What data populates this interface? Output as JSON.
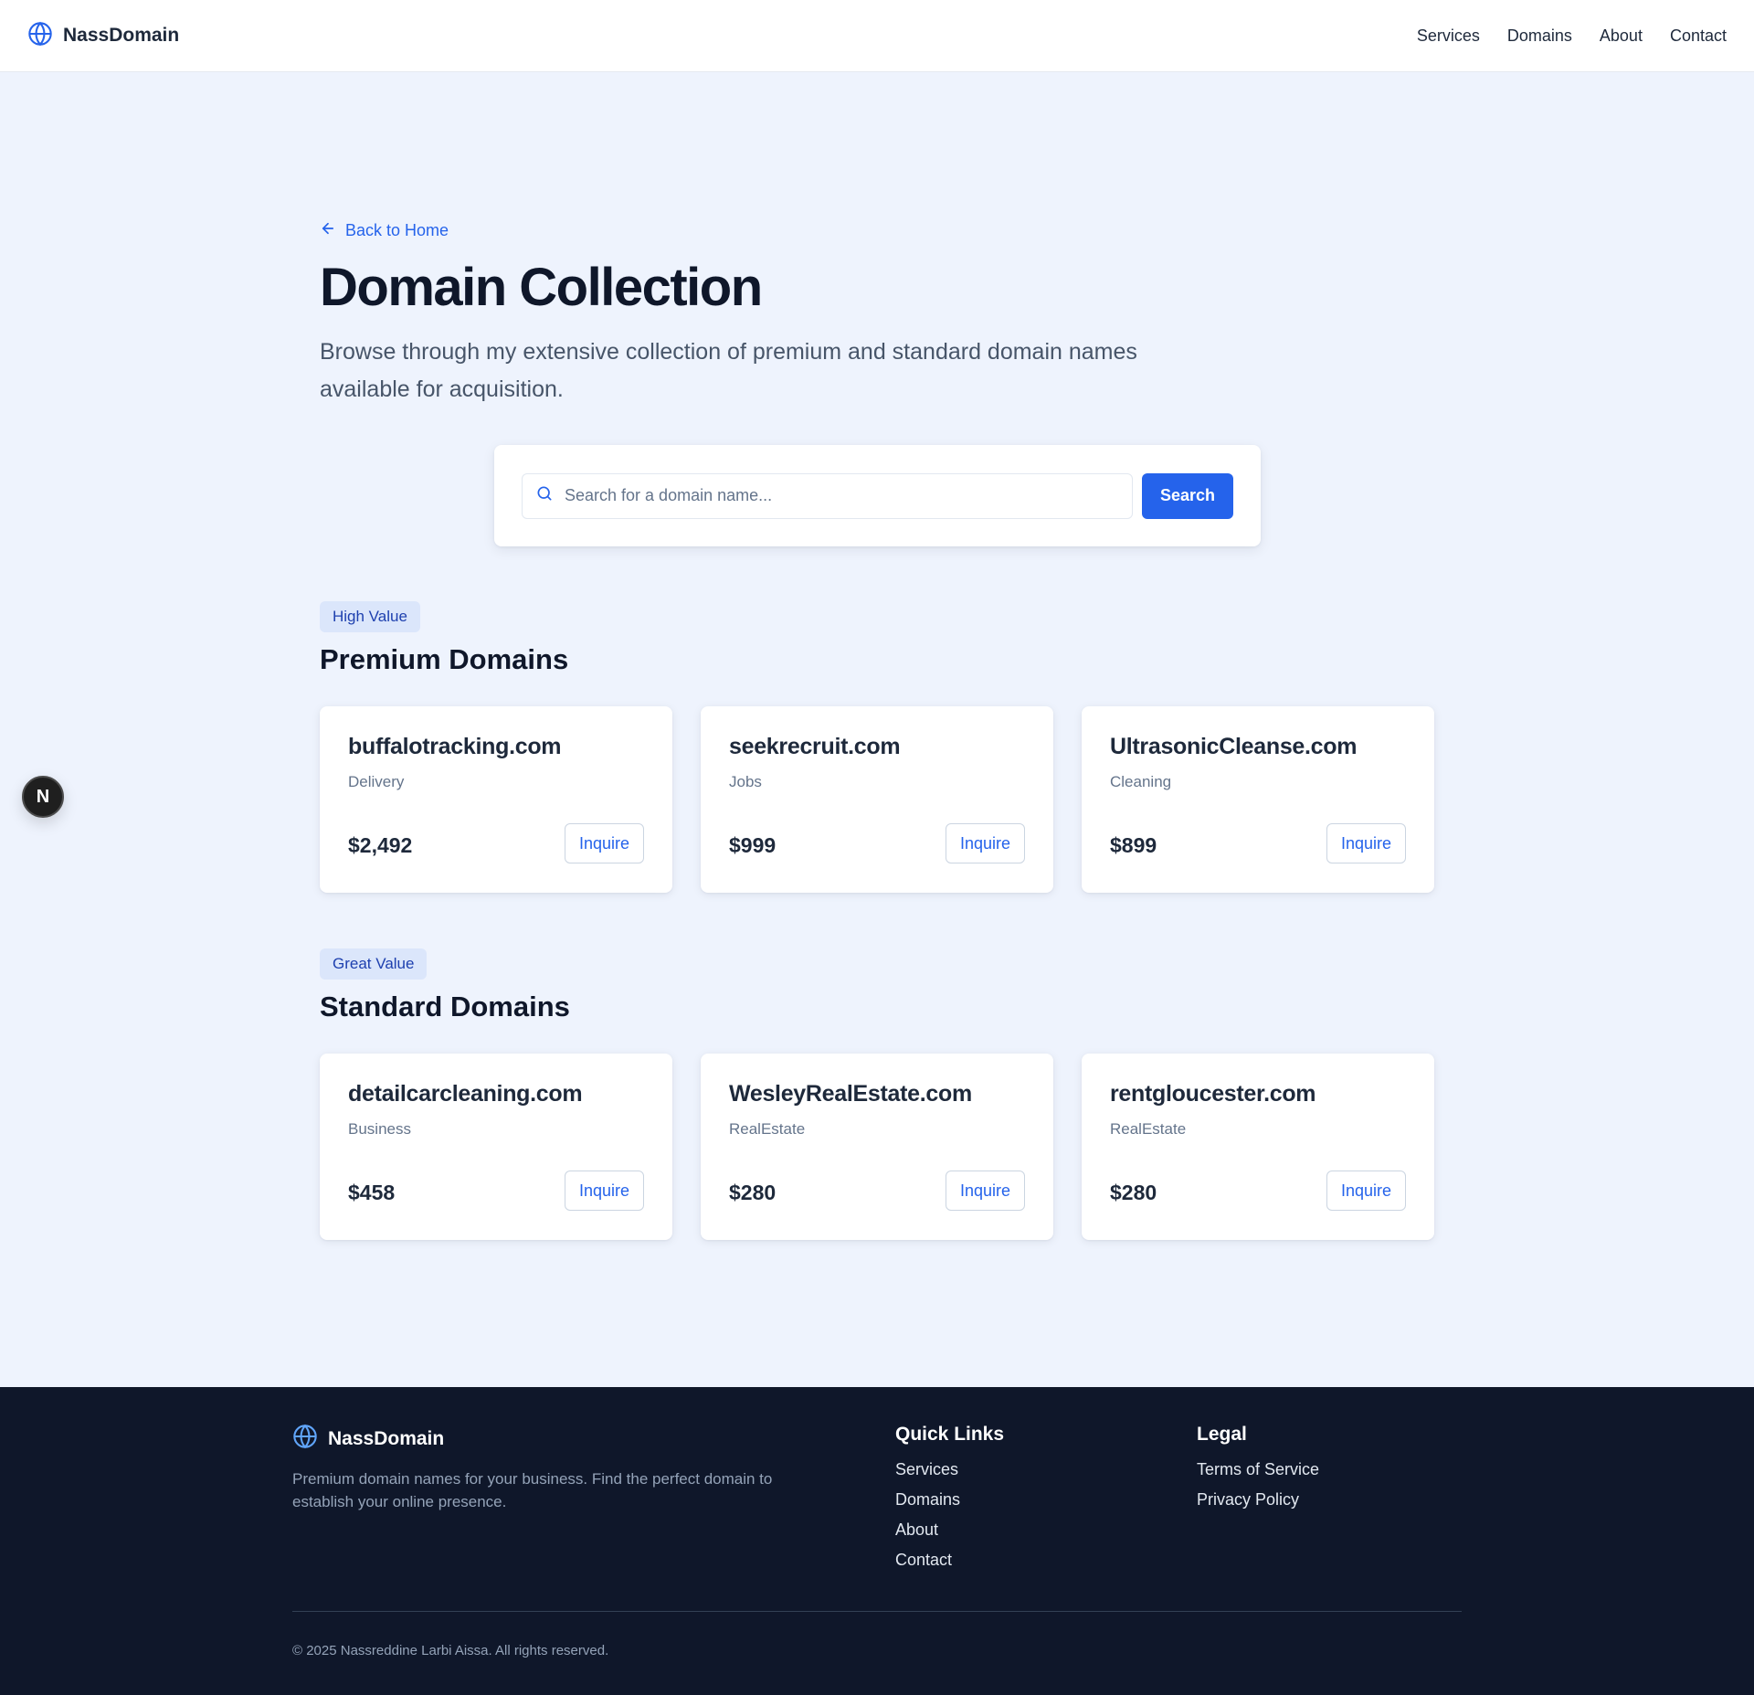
{
  "brand": {
    "name": "NassDomain"
  },
  "nav": {
    "services": "Services",
    "domains": "Domains",
    "about": "About",
    "contact": "Contact"
  },
  "hero": {
    "back": "Back to Home",
    "title": "Domain Collection",
    "description": "Browse through my extensive collection of premium and standard domain names available for acquisition."
  },
  "search": {
    "placeholder": "Search for a domain name...",
    "button": "Search"
  },
  "premium": {
    "badge": "High Value",
    "title": "Premium Domains",
    "items": [
      {
        "name": "buffalotracking.com",
        "category": "Delivery",
        "price": "$2,492",
        "cta": "Inquire"
      },
      {
        "name": "seekrecruit.com",
        "category": "Jobs",
        "price": "$999",
        "cta": "Inquire"
      },
      {
        "name": "UltrasonicCleanse.com",
        "category": "Cleaning",
        "price": "$899",
        "cta": "Inquire"
      }
    ]
  },
  "standard": {
    "badge": "Great Value",
    "title": "Standard Domains",
    "items": [
      {
        "name": "detailcarcleaning.com",
        "category": "Business",
        "price": "$458",
        "cta": "Inquire"
      },
      {
        "name": "WesleyRealEstate.com",
        "category": "RealEstate",
        "price": "$280",
        "cta": "Inquire"
      },
      {
        "name": "rentgloucester.com",
        "category": "RealEstate",
        "price": "$280",
        "cta": "Inquire"
      }
    ]
  },
  "floating": {
    "letter": "N"
  },
  "footer": {
    "brand": "NassDomain",
    "description": "Premium domain names for your business. Find the perfect domain to establish your online presence.",
    "quick_links": {
      "title": "Quick Links",
      "items": [
        "Services",
        "Domains",
        "About",
        "Contact"
      ]
    },
    "legal": {
      "title": "Legal",
      "items": [
        "Terms of Service",
        "Privacy Policy"
      ]
    },
    "copyright": "© 2025 Nassreddine Larbi Aissa. All rights reserved."
  },
  "colors": {
    "accent": "#2563eb",
    "background": "#eef3fd",
    "footer": "#0f172a",
    "badge_bg": "#dbe6fb"
  },
  "icons": {
    "brand": "globe-icon",
    "back": "arrow-left-icon",
    "search": "search-icon"
  }
}
